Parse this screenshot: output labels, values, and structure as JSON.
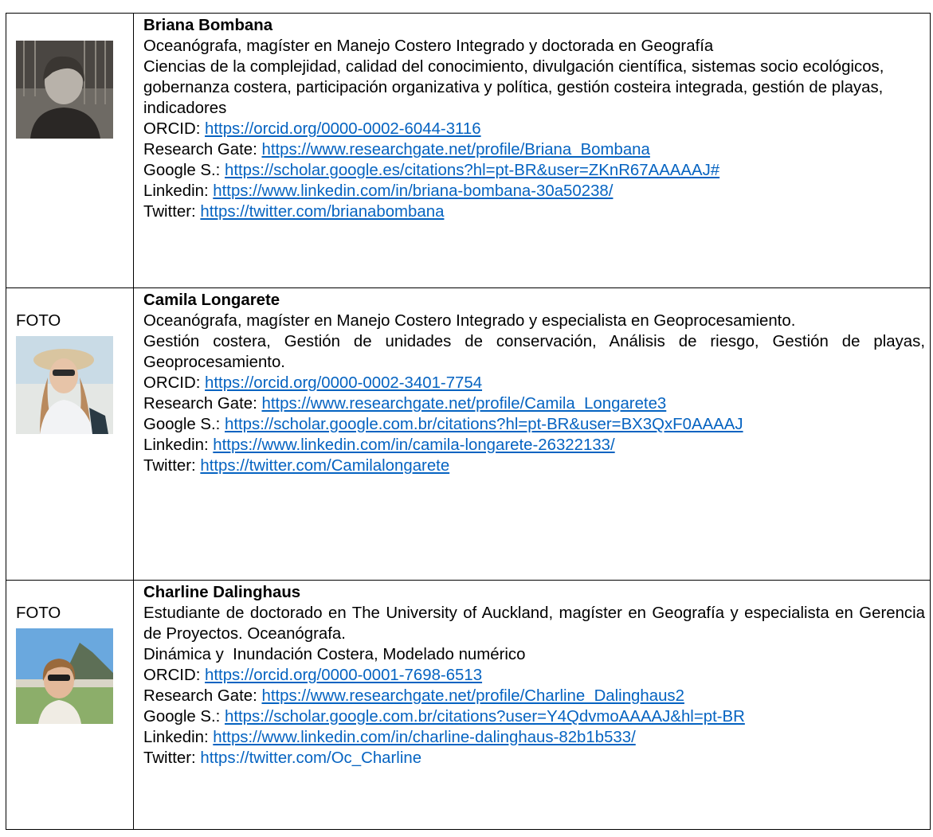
{
  "profiles": [
    {
      "photo_label": "",
      "name": "Briana Bombana",
      "degree": "Oceanógrafa, magíster en Manejo Costero Integrado y doctorada en Geografía",
      "topics": "Ciencias de la complejidad, calidad del conocimiento, divulgación científica, sistemas socio ecológicos, gobernanza costera, participación organizativa y política, gestión costeira integrada, gestión de playas, indicadores",
      "links": [
        {
          "label": "ORCID: ",
          "url": "https://orcid.org/0000-0002-6044-3116"
        },
        {
          "label": "Research Gate: ",
          "url": "https://www.researchgate.net/profile/Briana_Bombana"
        },
        {
          "label": "Google S.: ",
          "url": "https://scholar.google.es/citations?hl=pt-BR&user=ZKnR67AAAAAJ#"
        },
        {
          "label": "Linkedin: ",
          "url": "https://www.linkedin.com/in/briana-bombana-30a50238/"
        },
        {
          "label": "Twitter: ",
          "url": "https://twitter.com/brianabombana"
        }
      ]
    },
    {
      "photo_label": "FOTO",
      "name": "Camila Longarete",
      "degree": "Oceanógrafa, magíster en Manejo Costero Integrado y especialista en Geoprocesamiento.",
      "topics": "Gestión costera, Gestión de unidades de conservación, Análisis de riesgo, Gestión de playas, Geoprocesamiento.",
      "links": [
        {
          "label": "ORCID: ",
          "url": "https://orcid.org/0000-0002-3401-7754"
        },
        {
          "label": "Research Gate: ",
          "url": "https://www.researchgate.net/profile/Camila_Longarete3"
        },
        {
          "label": "Google S.: ",
          "url": "https://scholar.google.com.br/citations?hl=pt-BR&user=BX3QxF0AAAAJ"
        },
        {
          "label": "Linkedin: ",
          "url": "https://www.linkedin.com/in/camila-longarete-26322133/"
        },
        {
          "label": "Twitter: ",
          "url": "https://twitter.com/Camilalongarete"
        }
      ]
    },
    {
      "photo_label": "FOTO",
      "name": "Charline Dalinghaus",
      "degree": "Estudiante de doctorado en The University of Auckland, magíster en Geografía y especialista en Gerencia de Proyectos. Oceanógrafa.",
      "topics": "Dinámica y  Inundación Costera, Modelado numérico",
      "links": [
        {
          "label": "ORCID: ",
          "url": "https://orcid.org/0000-0001-7698-6513"
        },
        {
          "label": "Research Gate: ",
          "url": "https://www.researchgate.net/profile/Charline_Dalinghaus2"
        },
        {
          "label": "Google S.: ",
          "url": "https://scholar.google.com.br/citations?user=Y4QdvmoAAAAJ&hl=pt-BR"
        },
        {
          "label": "Linkedin: ",
          "url": "https://www.linkedin.com/in/charline-dalinghaus-82b1b533/"
        },
        {
          "label": "Twitter: ",
          "url": "https://twitter.com/Oc_Charline"
        }
      ]
    }
  ]
}
